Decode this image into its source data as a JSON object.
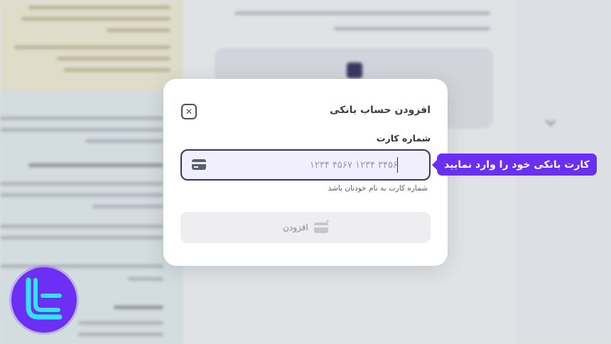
{
  "modal": {
    "title": "افزودن حساب بانکی",
    "close_icon": "close-icon",
    "card_field": {
      "label": "شماره کارت",
      "placeholder": "۱۲۳۴ ۴۵۶۷ ۱۲۳۴ ۳۴۵۶",
      "icon": "credit-card-icon",
      "helper": "شماره کارت به نام خودتان باشد"
    },
    "submit": {
      "label": "افزودن",
      "icon": "add-card-icon",
      "disabled": true
    }
  },
  "annotation": {
    "text": "کارت بانکی خود را وارد نمایید"
  },
  "colors": {
    "accent": "#6a2ff0",
    "input_border": "#3a3660",
    "input_bg": "#f1effb",
    "button_disabled_bg": "#eeeef1"
  }
}
